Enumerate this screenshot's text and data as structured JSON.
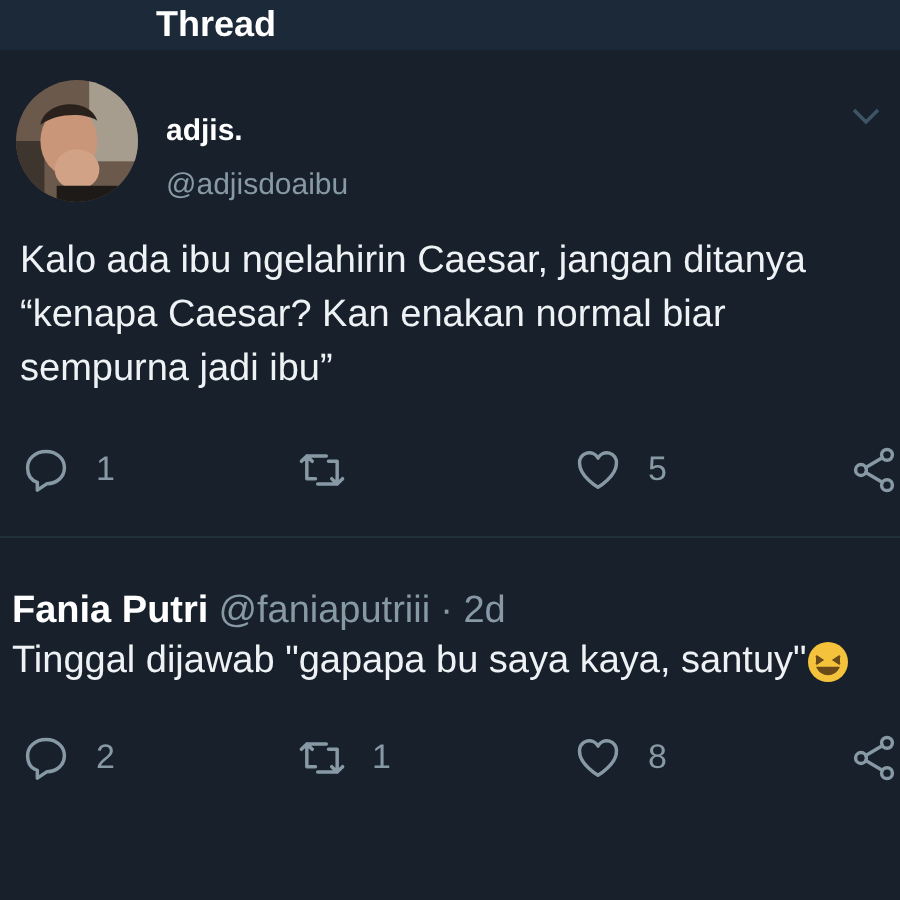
{
  "header": {
    "title": "Thread"
  },
  "tweet": {
    "name": "adjis.",
    "handle": "@adjisdoaibu",
    "text": "Kalo ada ibu ngelahirin Caesar, jangan ditanya “kenapa Caesar? Kan enakan normal biar sempurna jadi ibu”",
    "actions": [
      {
        "kind": "reply",
        "count": "1"
      },
      {
        "kind": "retweet"
      },
      {
        "kind": "like",
        "count": "5"
      },
      {
        "kind": "share"
      }
    ]
  },
  "reply": {
    "name": "Fania Putri",
    "handle": "@faniaputriii",
    "time": "· 2d",
    "text": "Tinggal dijawab \"gapapa bu saya kaya, santuy\"",
    "actions": [
      {
        "kind": "reply",
        "count": "2"
      },
      {
        "kind": "retweet",
        "count": "1"
      },
      {
        "kind": "like",
        "count": "8"
      },
      {
        "kind": "share"
      }
    ]
  }
}
